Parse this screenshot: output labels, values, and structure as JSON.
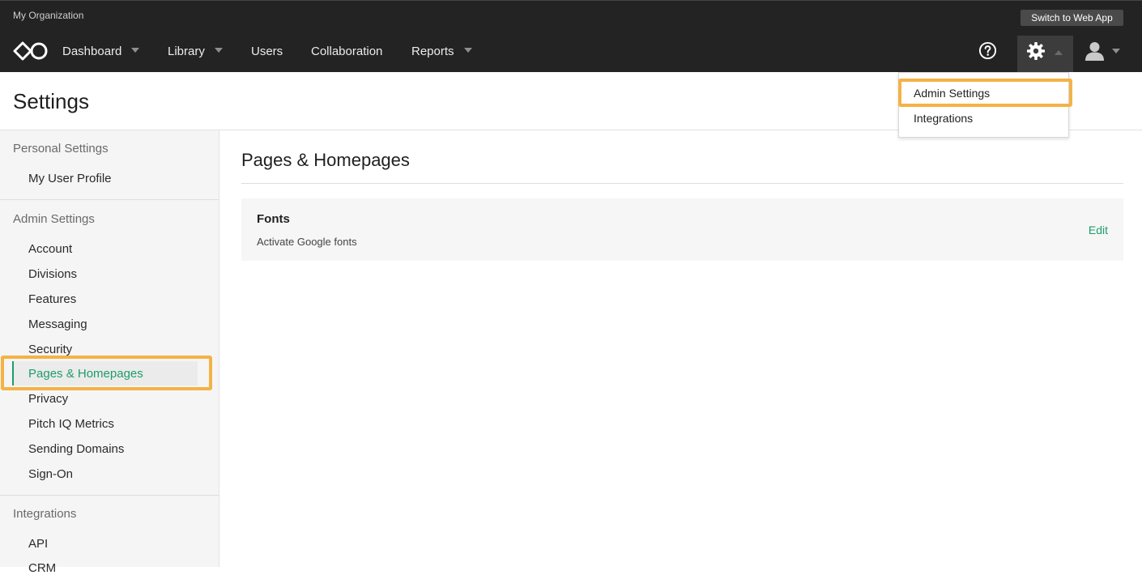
{
  "topbar": {
    "org_name": "My Organization",
    "switch_button": "Switch to Web App",
    "nav": {
      "dashboard": "Dashboard",
      "library": "Library",
      "users": "Users",
      "collaboration": "Collaboration",
      "reports": "Reports"
    },
    "icons": [
      "logo-icon",
      "help-icon",
      "gear-icon",
      "user-icon"
    ]
  },
  "settings_menu": {
    "items": [
      "Admin Settings",
      "Integrations"
    ],
    "highlighted": "Admin Settings"
  },
  "page": {
    "title": "Settings"
  },
  "sidebar": {
    "sections": [
      {
        "title": "Personal Settings",
        "items": [
          "My User Profile"
        ]
      },
      {
        "title": "Admin Settings",
        "items": [
          "Account",
          "Divisions",
          "Features",
          "Messaging",
          "Security",
          "Pages & Homepages",
          "Privacy",
          "Pitch IQ Metrics",
          "Sending Domains",
          "Sign-On"
        ]
      },
      {
        "title": "Integrations",
        "items": [
          "API",
          "CRM"
        ]
      }
    ],
    "active_item": "Pages & Homepages"
  },
  "main": {
    "title": "Pages & Homepages",
    "card": {
      "title": "Fonts",
      "description": "Activate Google fonts",
      "action": "Edit"
    }
  },
  "colors": {
    "topbar_bg": "#232323",
    "accent_green": "#1c9d6b",
    "highlight_orange": "#f4b246",
    "sidebar_bg": "#f5f5f5"
  }
}
